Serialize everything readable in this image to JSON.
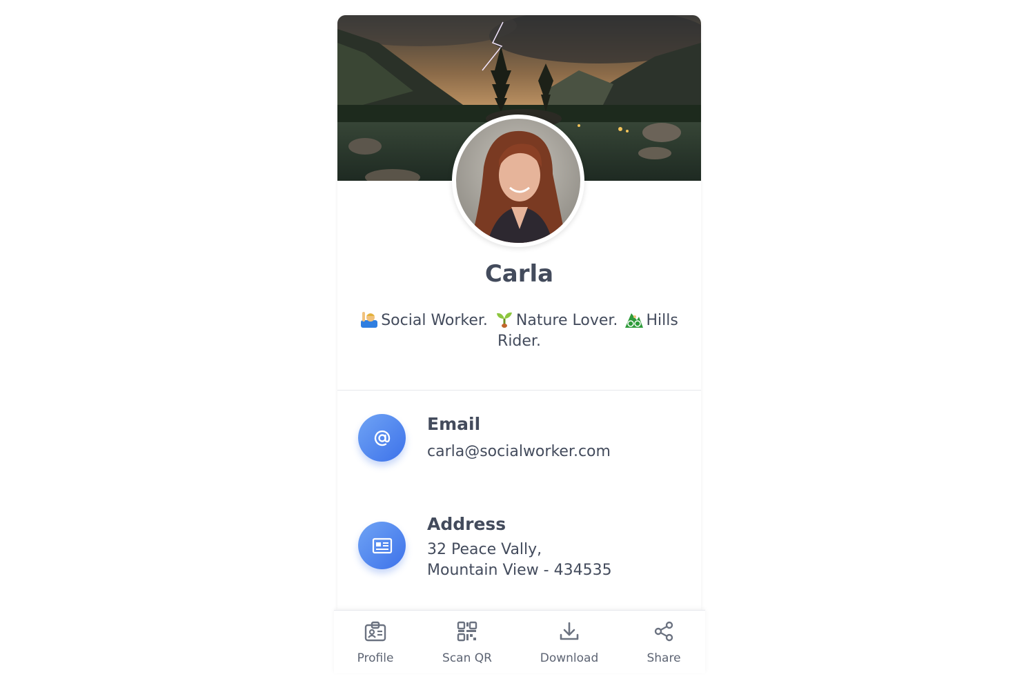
{
  "profile": {
    "name": "Carla",
    "bio": [
      {
        "emoji": "person-raising-hand-emoji",
        "text": "Social Worker."
      },
      {
        "emoji": "seedling-emoji",
        "text": "Nature Lover."
      },
      {
        "emoji": "mountain-biker-emoji",
        "text": "Hills Rider."
      }
    ]
  },
  "contacts": {
    "email": {
      "label": "Email",
      "value": "carla@socialworker.com",
      "icon": "at-icon"
    },
    "address": {
      "label": "Address",
      "value": "32 Peace Vally,\nMountain View - 434535",
      "icon": "id-card-icon"
    }
  },
  "nav": {
    "profile": {
      "label": "Profile",
      "icon": "badge-icon"
    },
    "scan": {
      "label": "Scan QR",
      "icon": "qr-code-icon"
    },
    "download": {
      "label": "Download",
      "icon": "download-icon"
    },
    "share": {
      "label": "Share",
      "icon": "share-icon"
    }
  },
  "colors": {
    "accent_start": "#6fa3f4",
    "accent_end": "#3d72ea",
    "text": "#434b5c"
  }
}
